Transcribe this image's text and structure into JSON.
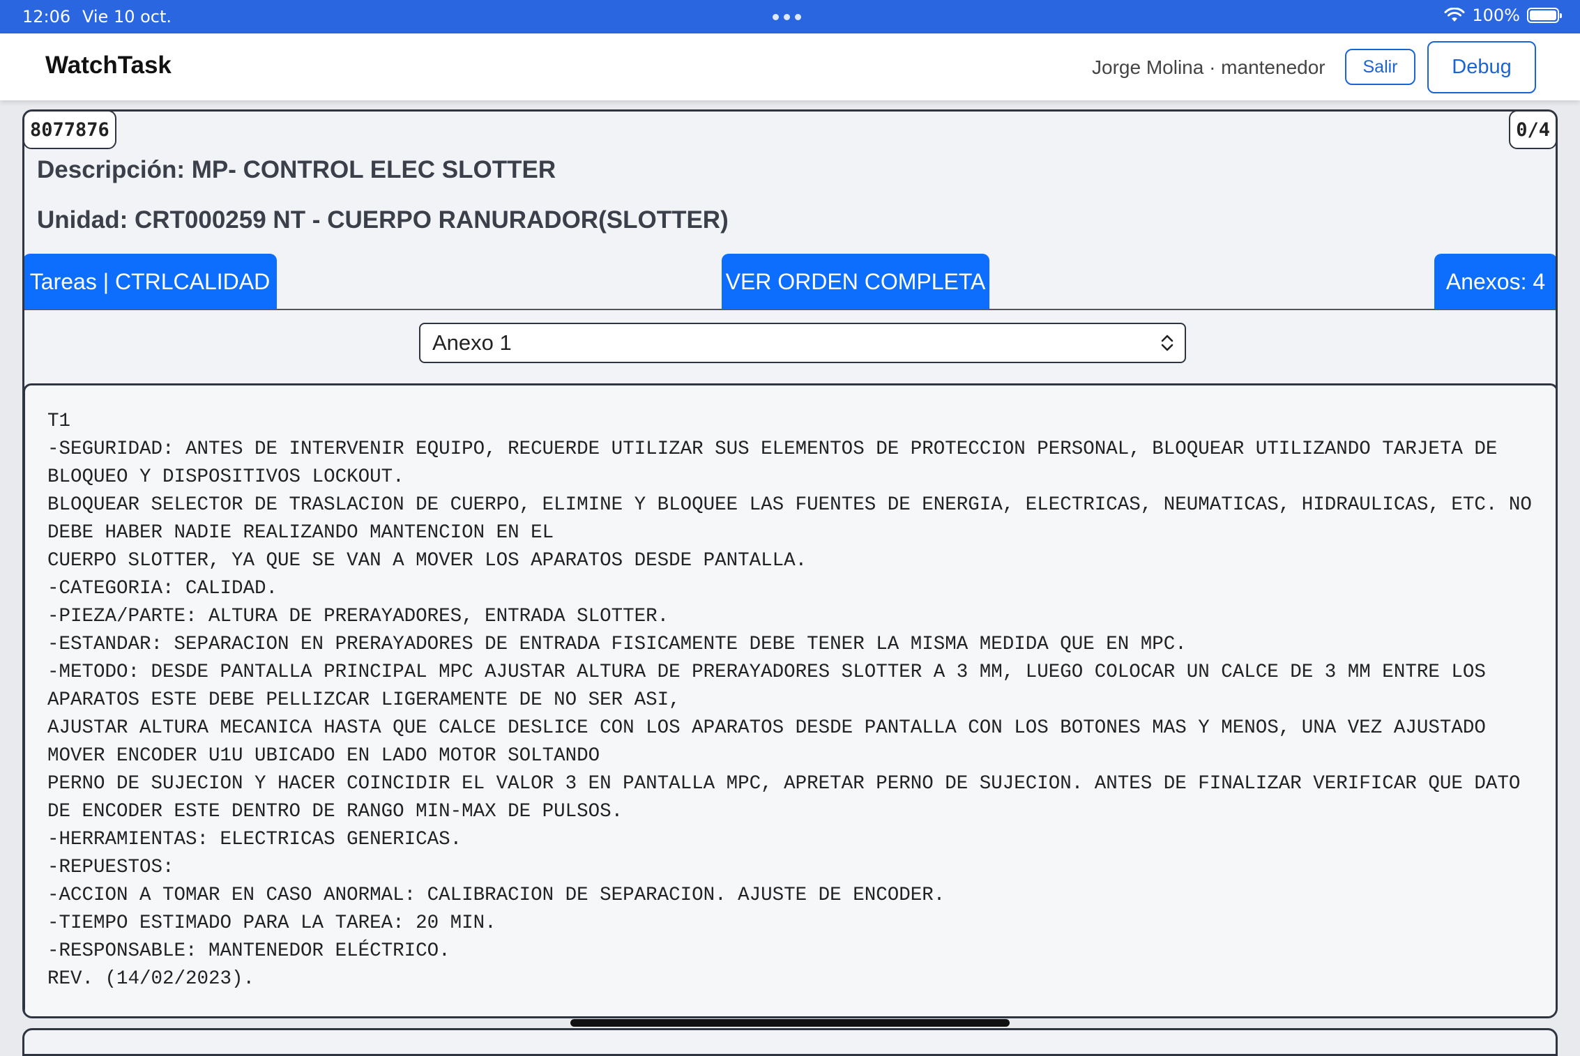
{
  "status_bar": {
    "time": "12:06",
    "date": "Vie 10 oct.",
    "battery": "100%",
    "wifi_icon": "wifi-icon",
    "battery_icon": "battery-icon"
  },
  "header": {
    "app_name": "WatchTask",
    "user": "Jorge Molina · mantenedor",
    "logout_label": "Salir",
    "debug_label": "Debug"
  },
  "order": {
    "id": "8077876",
    "progress": "0/4",
    "description": "Descripción: MP- CONTROL ELEC SLOTTER",
    "unit": "Unidad: CRT000259 NT - CUERPO RANURADOR(SLOTTER)",
    "tasks_tab_label": "Tareas | CTRLCALIDAD",
    "full_order_label": "VER ORDEN COMPLETA",
    "attachments_label": "Anexos: 4",
    "attachment_selected": "Anexo 1",
    "attachment_text": "T1\n-SEGURIDAD: ANTES DE INTERVENIR EQUIPO, RECUERDE UTILIZAR SUS ELEMENTOS DE PROTECCION PERSONAL, BLOQUEAR UTILIZANDO TARJETA DE BLOQUEO Y DISPOSITIVOS LOCKOUT.\nBLOQUEAR SELECTOR DE TRASLACION DE CUERPO, ELIMINE Y BLOQUEE LAS FUENTES DE ENERGIA, ELECTRICAS, NEUMATICAS, HIDRAULICAS, ETC. NO DEBE HABER NADIE REALIZANDO MANTENCION EN EL\nCUERPO SLOTTER, YA QUE SE VAN A MOVER LOS APARATOS DESDE PANTALLA.\n-CATEGORIA: CALIDAD.\n-PIEZA/PARTE: ALTURA DE PRERAYADORES, ENTRADA SLOTTER.\n-ESTANDAR: SEPARACION EN PRERAYADORES DE ENTRADA FISICAMENTE DEBE TENER LA MISMA MEDIDA QUE EN MPC.\n-METODO: DESDE PANTALLA PRINCIPAL MPC AJUSTAR ALTURA DE PRERAYADORES SLOTTER A 3 MM, LUEGO COLOCAR UN CALCE DE 3 MM ENTRE LOS APARATOS ESTE DEBE PELLIZCAR LIGERAMENTE DE NO SER ASI,\nAJUSTAR ALTURA MECANICA HASTA QUE CALCE DESLICE CON LOS APARATOS DESDE PANTALLA CON LOS BOTONES MAS Y MENOS, UNA VEZ AJUSTADO MOVER ENCODER U1U UBICADO EN LADO MOTOR SOLTANDO\nPERNO DE SUJECION Y HACER COINCIDIR EL VALOR 3 EN PANTALLA MPC, APRETAR PERNO DE SUJECION. ANTES DE FINALIZAR VERIFICAR QUE DATO DE ENCODER ESTE DENTRO DE RANGO MIN-MAX DE PULSOS.\n-HERRAMIENTAS: ELECTRICAS GENERICAS.\n-REPUESTOS:\n-ACCION A TOMAR EN CASO ANORMAL: CALIBRACION DE SEPARACION. AJUSTE DE ENCODER.\n-TIEMPO ESTIMADO PARA LA TAREA: 20 MIN.\n-RESPONSABLE: MANTENEDOR ELÉCTRICO.\nREV. (14/02/2023)."
  },
  "colors": {
    "status_bar": "#2a66df",
    "primary_button": "#0d6efd",
    "outline_button": "#1a64d6"
  }
}
